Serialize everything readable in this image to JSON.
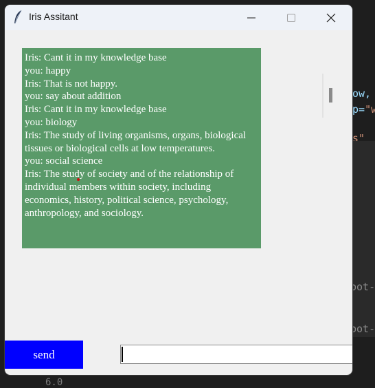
{
  "window": {
    "title": "Iris Assitant"
  },
  "chat": {
    "lines": [
      "Iris: Cant it in my knowledge base",
      "you: happy",
      "Iris: That is not happy.",
      "you: say about addition",
      "Iris: Cant it in my knowledge base",
      "you: biology",
      "Iris: The study of living organisms, organs, biological tissues or biological cells at low temperatures.",
      "you: social science",
      "Iris: The study of society and of the relationship of individual members within society, including economics, history, political science, psychology, anthropology, and sociology."
    ]
  },
  "controls": {
    "send_label": "send",
    "input_value": ""
  },
  "background_code": {
    "line1": "ow,",
    "line2_prefix": "p=",
    "line2_string": "\"w",
    "line3": "s\"",
    "line4": "bot-",
    "line5": "bot-",
    "line6": "6.0"
  },
  "colors": {
    "chat_background": "#5a9a69",
    "send_button": "#0000ff",
    "titlebar": "#eef2f8",
    "window_body": "#f0f0f0"
  }
}
